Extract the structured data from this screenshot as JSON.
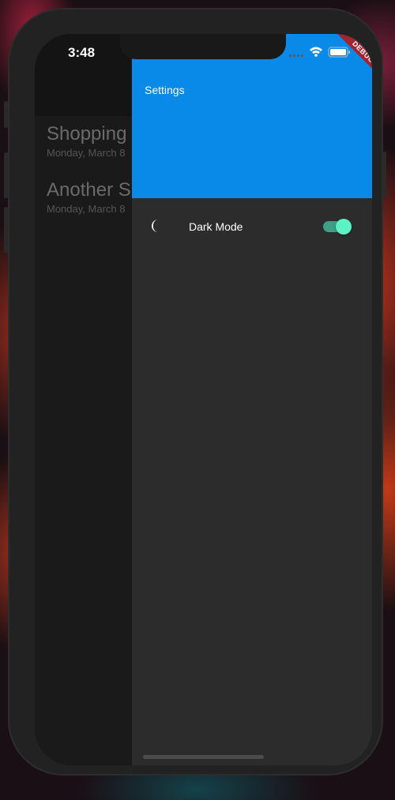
{
  "status_bar": {
    "time": "3:48"
  },
  "background_list": {
    "items": [
      {
        "title": "Shopping",
        "date": "Monday, March 8"
      },
      {
        "title": "Another S",
        "date": "Monday, March 8"
      }
    ]
  },
  "drawer": {
    "header_title": "Settings",
    "items": [
      {
        "label": "Dark Mode",
        "icon": "moon-icon",
        "toggle_on": true
      }
    ]
  },
  "debug_banner": "DEBUG",
  "colors": {
    "header_blue": "#0989e8",
    "drawer_bg": "#2c2c2c",
    "switch_thumb": "#5bf2c4",
    "switch_track": "#3d9f86"
  }
}
